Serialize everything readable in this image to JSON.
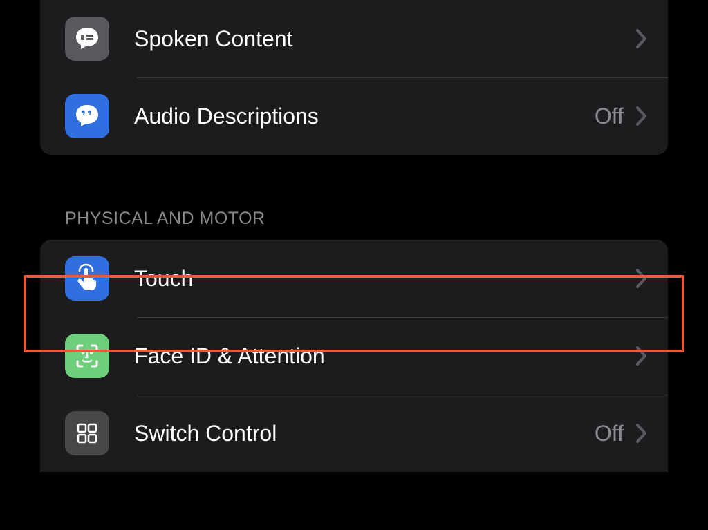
{
  "groups": [
    {
      "items": [
        {
          "id": "spoken-content",
          "icon": "speech-bubble",
          "icon_bg": "gray",
          "label": "Spoken Content",
          "value": ""
        },
        {
          "id": "audio-descriptions",
          "icon": "quote-bubble",
          "icon_bg": "blue",
          "label": "Audio Descriptions",
          "value": "Off"
        }
      ]
    },
    {
      "header": "PHYSICAL AND MOTOR",
      "items": [
        {
          "id": "touch",
          "icon": "pointing-hand",
          "icon_bg": "blue",
          "label": "Touch",
          "value": "",
          "highlighted": true
        },
        {
          "id": "face-id-attention",
          "icon": "face-id",
          "icon_bg": "green",
          "label": "Face ID & Attention",
          "value": ""
        },
        {
          "id": "switch-control",
          "icon": "grid-squares",
          "icon_bg": "dark",
          "label": "Switch Control",
          "value": "Off"
        }
      ]
    }
  ],
  "colors": {
    "highlight": "#e85a3f",
    "row_bg": "#1c1c1e",
    "chevron": "#8a8a8e"
  }
}
